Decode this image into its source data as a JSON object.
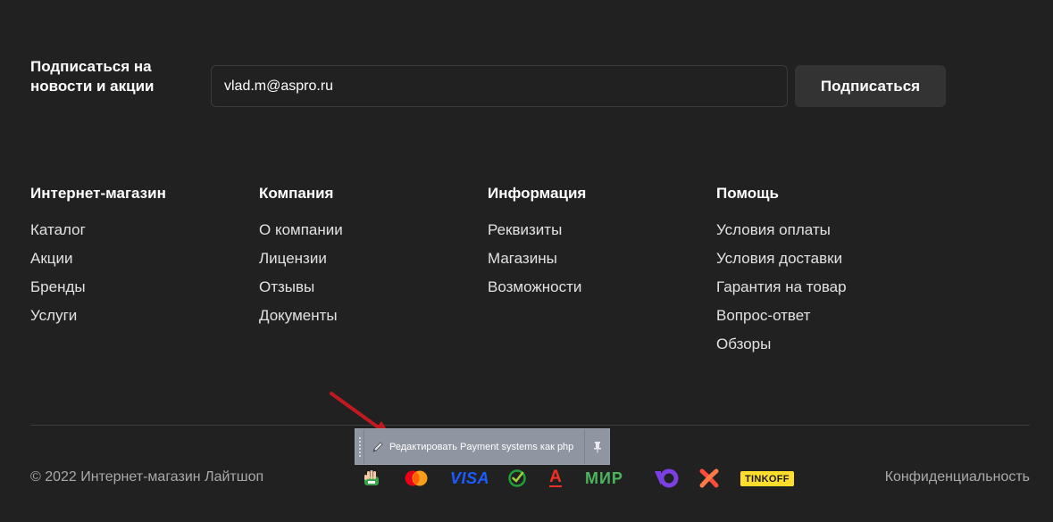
{
  "subscribe": {
    "title": "Подписаться на новости и акции",
    "email_value": "vlad.m@aspro.ru",
    "button_label": "Подписаться"
  },
  "menu": [
    {
      "title": "Интернет-магазин",
      "items": [
        "Каталог",
        "Акции",
        "Бренды",
        "Услуги"
      ]
    },
    {
      "title": "Компания",
      "items": [
        "О компании",
        "Лицензии",
        "Отзывы",
        "Документы"
      ]
    },
    {
      "title": "Информация",
      "items": [
        "Реквизиты",
        "Магазины",
        "Возможности"
      ]
    },
    {
      "title": "Помощь",
      "items": [
        "Условия оплаты",
        "Условия доставки",
        "Гарантия на товар",
        "Вопрос-ответ",
        "Обзоры"
      ]
    }
  ],
  "edit_toolbar": {
    "label": "Редактировать Payment systems как php"
  },
  "footer": {
    "copyright": "© 2022 Интернет-магазин Лайтшоп",
    "privacy": "Конфиденциальность"
  },
  "payments": {
    "visa_text": "VISA",
    "mir_text": "МИР",
    "tinkoff_text": "TINKOFF",
    "alfa_text": "А"
  },
  "colors": {
    "background": "#212121",
    "accent_arrow": "#c0191f",
    "tinkoff_yellow": "#ffdd2d",
    "mir_green": "#4db45e",
    "visa_blue": "#1a5cff",
    "yoomoney_purple": "#7b3fe4"
  }
}
